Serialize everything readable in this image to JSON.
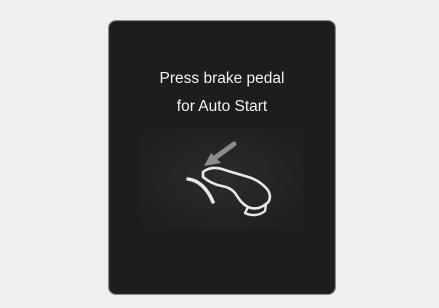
{
  "display": {
    "message_line1": "Press brake pedal",
    "message_line2": "for Auto Start"
  },
  "icons": {
    "pedal": "foot-on-brake-pedal-icon",
    "arrow": "press-down-arrow-icon"
  },
  "colors": {
    "background": "#efefef",
    "panel": "#1d1d1d",
    "text": "#f2f2f2",
    "icon": "#e8e8e8",
    "arrow": "#8c8c8c"
  }
}
